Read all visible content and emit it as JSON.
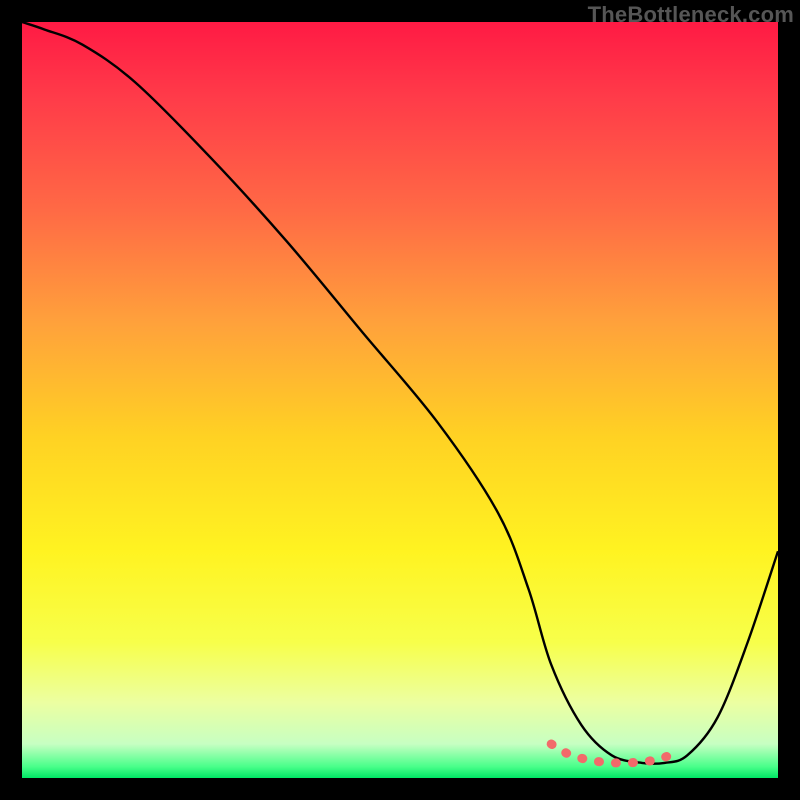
{
  "watermark": "TheBottleneck.com",
  "gradient_stops": [
    {
      "offset": 0.0,
      "color": "#ff1a44"
    },
    {
      "offset": 0.1,
      "color": "#ff3b49"
    },
    {
      "offset": 0.25,
      "color": "#ff6a45"
    },
    {
      "offset": 0.4,
      "color": "#ffa23b"
    },
    {
      "offset": 0.55,
      "color": "#ffd223"
    },
    {
      "offset": 0.7,
      "color": "#fff321"
    },
    {
      "offset": 0.82,
      "color": "#f7ff4a"
    },
    {
      "offset": 0.9,
      "color": "#ecffa1"
    },
    {
      "offset": 0.955,
      "color": "#c7ffc2"
    },
    {
      "offset": 0.985,
      "color": "#49ff8a"
    },
    {
      "offset": 1.0,
      "color": "#00e765"
    }
  ],
  "chart_data": {
    "type": "line",
    "title": "",
    "xlabel": "",
    "ylabel": "",
    "xlim": [
      0,
      100
    ],
    "ylim": [
      0,
      100
    ],
    "grid": false,
    "legend": false,
    "series": [
      {
        "name": "curve",
        "color": "#000000",
        "x": [
          0,
          3,
          8,
          15,
          25,
          35,
          45,
          55,
          63,
          67,
          70,
          74,
          78,
          82,
          85,
          88,
          92,
          96,
          100
        ],
        "values": [
          100,
          99,
          97,
          92,
          82,
          71,
          59,
          47,
          35,
          25,
          15,
          7,
          3,
          2,
          2,
          3,
          8,
          18,
          30
        ]
      },
      {
        "name": "bottom-markers",
        "color": "#f26a6a",
        "type": "scatter",
        "x": [
          70,
          72,
          74,
          76,
          78,
          80,
          82,
          84,
          86,
          87
        ],
        "values": [
          4.5,
          3.3,
          2.6,
          2.2,
          2.0,
          2.0,
          2.1,
          2.4,
          3.1,
          3.8
        ]
      }
    ]
  }
}
